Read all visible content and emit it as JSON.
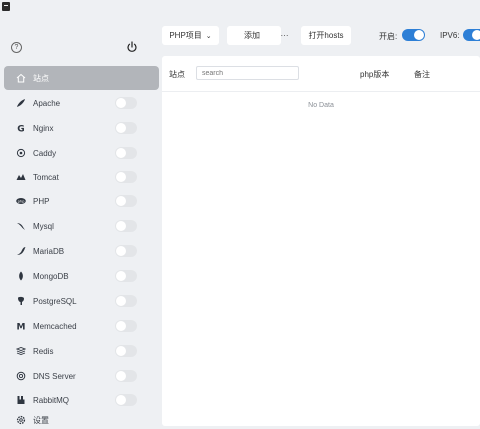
{
  "sidebar": {
    "items": [
      {
        "id": "site",
        "label": "站点",
        "icon": "home-icon",
        "active": true
      },
      {
        "id": "apache",
        "label": "Apache",
        "icon": "apache-feather-icon"
      },
      {
        "id": "nginx",
        "label": "Nginx",
        "icon": "nginx-icon"
      },
      {
        "id": "caddy",
        "label": "Caddy",
        "icon": "caddy-icon"
      },
      {
        "id": "tomcat",
        "label": "Tomcat",
        "icon": "tomcat-icon"
      },
      {
        "id": "php",
        "label": "PHP",
        "icon": "php-icon"
      },
      {
        "id": "mysql",
        "label": "Mysql",
        "icon": "mysql-icon"
      },
      {
        "id": "mariadb",
        "label": "MariaDB",
        "icon": "mariadb-icon"
      },
      {
        "id": "mongodb",
        "label": "MongoDB",
        "icon": "mongodb-leaf-icon"
      },
      {
        "id": "postgresql",
        "label": "PostgreSQL",
        "icon": "postgresql-icon"
      },
      {
        "id": "memcached",
        "label": "Memcached",
        "icon": "memcached-icon"
      },
      {
        "id": "redis",
        "label": "Redis",
        "icon": "redis-icon"
      },
      {
        "id": "dns",
        "label": "DNS Server",
        "icon": "dns-icon"
      },
      {
        "id": "rabbitmq",
        "label": "RabbitMQ",
        "icon": "rabbitmq-icon"
      },
      {
        "id": "settings",
        "label": "设置",
        "icon": "gear-icon"
      }
    ]
  },
  "toolbar": {
    "project_select": "PHP项目",
    "add_label": "添加",
    "more_label": "···",
    "hosts_label": "打开hosts",
    "enable_label": "开启:",
    "ipv6_label": "IPV6:"
  },
  "main": {
    "site_label": "站点",
    "search_placeholder": "search",
    "col_php_version": "php版本",
    "col_note": "备注",
    "empty_text": "No Data"
  },
  "colors": {
    "accent": "#2d7fd6",
    "active_nav": "#b2b5ba",
    "background": "#eef0f3"
  }
}
